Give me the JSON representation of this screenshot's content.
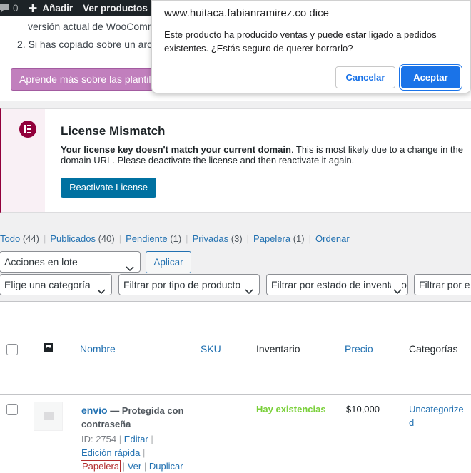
{
  "adminbar": {
    "comments_icon": "speech-bubble-icon",
    "comments_count": "0",
    "new_icon": "plus-icon",
    "new_label": "Añadir",
    "view_label": "Ver productos"
  },
  "top_notice": {
    "line1": "versión actual de WooComm",
    "line2": "2. Si has copiado sobre un arch",
    "button": "Aprende más sobre las plantilla"
  },
  "license_notice": {
    "icon": "elementor-logo-icon",
    "title": "License Mismatch",
    "desc_bold": "Your license key doesn't match your current domain",
    "desc_rest": ". This is most likely due to a change in the domain URL. Please deactivate the license and then reactivate it again.",
    "button": "Reactivate License"
  },
  "status_links": [
    {
      "label": "Todo",
      "count": "(44)"
    },
    {
      "label": "Publicados",
      "count": "(40)"
    },
    {
      "label": "Pendiente",
      "count": "(1)"
    },
    {
      "label": "Privadas",
      "count": "(3)"
    },
    {
      "label": "Papelera",
      "count": "(1)"
    },
    {
      "label": "Ordenar",
      "count": ""
    }
  ],
  "bulk": {
    "select_value": "Acciones en lote",
    "apply": "Aplicar"
  },
  "filters": {
    "category": "Elige una categoría",
    "product_type": "Filtrar por tipo de producto",
    "stock_status": "Filtrar por estado de inventario",
    "more": "Filtrar por e"
  },
  "table": {
    "headers": {
      "image_icon": "image-icon",
      "name": "Nombre",
      "sku": "SKU",
      "stock": "Inventario",
      "price": "Precio",
      "categories": "Categorías"
    },
    "rows": [
      {
        "name": "envio",
        "state": " — Protegida con contraseña",
        "id_text": "ID: 2754",
        "actions": {
          "edit": "Editar",
          "quick_edit": "Edición rápida",
          "trash": "Papelera",
          "view": "Ver",
          "duplicate": "Duplicar"
        },
        "sku": "–",
        "stock": "Hay existencias",
        "price": "$10,000",
        "category": "Uncategorized"
      }
    ]
  },
  "dialog": {
    "origin": "www.huitaca.fabianramirez.co dice",
    "message": "Este producto ha producido ventas y puede estar ligado a pedidos existentes. ¿Estás seguro de querer borrarlo?",
    "cancel": "Cancelar",
    "ok": "Aceptar"
  },
  "colors": {
    "admin_bar": "#1d2327",
    "link": "#2271b1",
    "elementor": "#92003b",
    "woo_button": "#c17fbd",
    "in_stock": "#7ad03a",
    "trash": "#b32d2e",
    "dialog_primary": "#1a73e8"
  }
}
